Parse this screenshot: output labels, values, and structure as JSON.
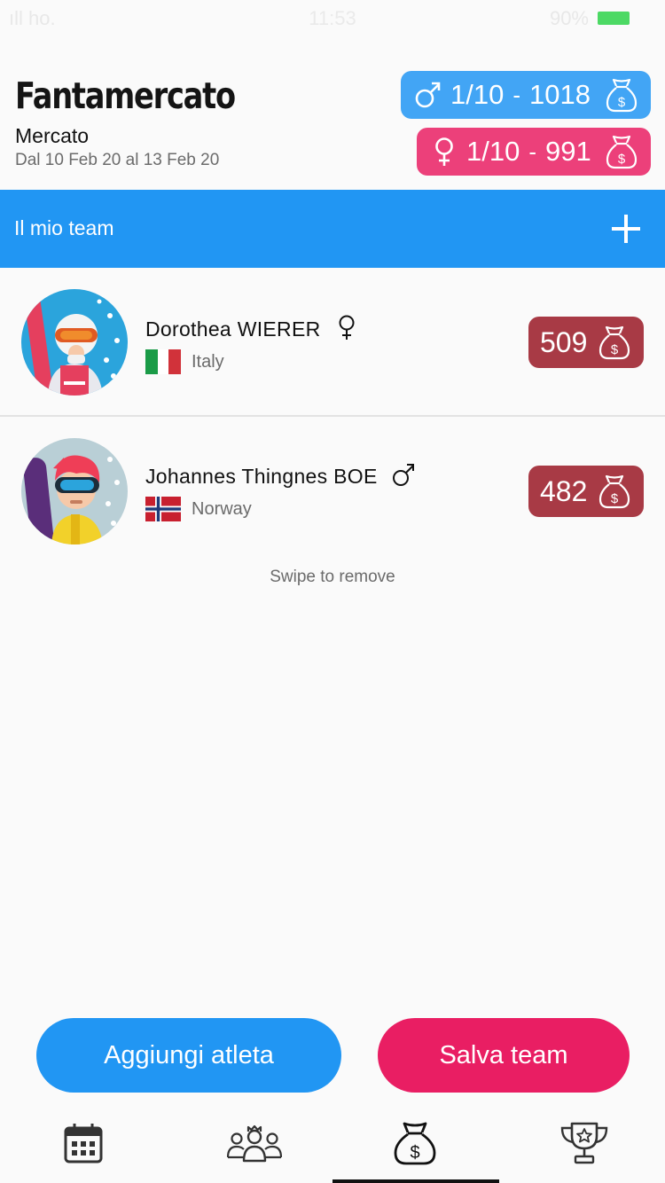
{
  "status_bar": {
    "carrier": "ıll ho.",
    "time": "11:53",
    "battery": "90%"
  },
  "header": {
    "title": "Fantamercato",
    "subtitle": "Mercato",
    "dates": "Dal 10 Feb 20 al 13 Feb 20"
  },
  "budgets": {
    "male": {
      "count": "1/10",
      "separator": "-",
      "amount": "1018"
    },
    "female": {
      "count": "1/10",
      "separator": "-",
      "amount": "991"
    }
  },
  "team_bar": {
    "label": "Il mio team"
  },
  "athletes": [
    {
      "name": "Dorothea WIERER",
      "gender": "female",
      "country": "Italy",
      "price": "509"
    },
    {
      "name": "Johannes Thingnes BOE",
      "gender": "male",
      "country": "Norway",
      "price": "482"
    }
  ],
  "hint": "Swipe to remove",
  "buttons": {
    "add_athlete": "Aggiungi atleta",
    "save_team": "Salva team"
  },
  "tabs": [
    "calendar-icon",
    "people-icon",
    "money-bag-icon",
    "trophy-icon"
  ],
  "colors": {
    "blue": "#2196f3",
    "pink": "#e91e63",
    "price": "#a83a45",
    "male_badge": "#42a5f5",
    "female_badge": "#ec407a"
  }
}
